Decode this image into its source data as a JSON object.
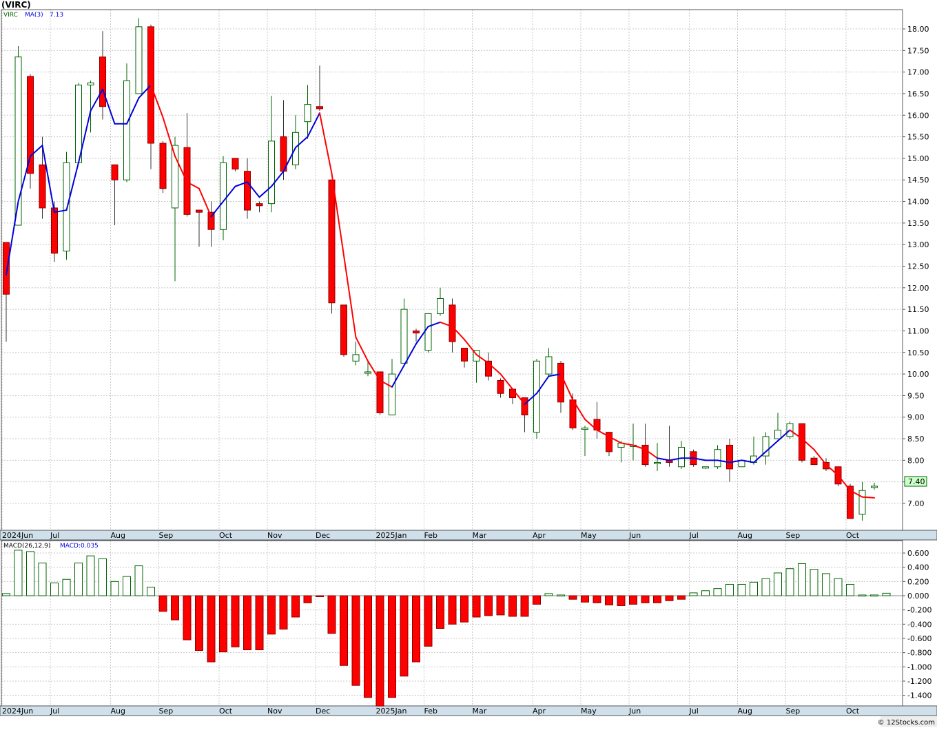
{
  "header": {
    "symbol": "(VIRC)",
    "legend_symbol": "VIRC",
    "legend_ma": "MA(3)",
    "legend_ma_value": "7.13",
    "macd_label": "MACD(26,12,9)",
    "macd_value": "MACD:0.035",
    "last_price": "7.40",
    "watermark": "© 12Stocks.com"
  },
  "colors": {
    "up": "#006400",
    "down": "#ff0000",
    "ma_up": "#0000dd",
    "ma_down": "#ff0000",
    "grid": "#c8c8c8",
    "axis_band": "#cfe0ea",
    "price_badge_bg": "#ccffcc"
  },
  "chart_data": [
    {
      "type": "candlestick",
      "title": "(VIRC)",
      "series_name": "VIRC",
      "overlay": "MA(3)",
      "ylim": [
        6.6,
        18.3
      ],
      "y_ticks": [
        7.0,
        7.5,
        8.0,
        8.5,
        9.0,
        9.5,
        10.0,
        10.5,
        11.0,
        11.5,
        12.0,
        12.5,
        13.0,
        13.5,
        14.0,
        14.5,
        15.0,
        15.5,
        16.0,
        16.5,
        17.0,
        17.5,
        18.0
      ],
      "y_tick_labels": [
        "7.00",
        "7.50",
        "8.00",
        "8.50",
        "9.00",
        "9.50",
        "10.00",
        "10.50",
        "11.00",
        "11.50",
        "12.00",
        "12.50",
        "13.00",
        "13.50",
        "14.00",
        "14.50",
        "15.00",
        "15.50",
        "16.00",
        "16.50",
        "17.00",
        "17.50",
        "18.00"
      ],
      "x_labels": [
        "2024Jun",
        "Jul",
        "Aug",
        "Sep",
        "Oct",
        "Nov",
        "Dec",
        "2025Jan",
        "Feb",
        "Mar",
        "Apr",
        "May",
        "Jun",
        "Jul",
        "Aug",
        "Sep",
        "Oct"
      ],
      "x_label_weeks": [
        0,
        4,
        9,
        13,
        18,
        22,
        26,
        31,
        35,
        39,
        44,
        48,
        52,
        57,
        61,
        65,
        70
      ],
      "ohlc": [
        [
          13.05,
          13.05,
          10.75,
          11.85
        ],
        [
          13.45,
          17.6,
          13.45,
          17.35
        ],
        [
          16.9,
          16.95,
          14.3,
          14.65
        ],
        [
          14.85,
          15.5,
          13.6,
          13.85
        ],
        [
          13.85,
          14.0,
          12.6,
          12.8
        ],
        [
          12.85,
          15.15,
          12.65,
          14.9
        ],
        [
          14.9,
          16.75,
          14.9,
          16.7
        ],
        [
          16.7,
          16.8,
          15.6,
          16.75
        ],
        [
          17.35,
          17.95,
          15.9,
          16.2
        ],
        [
          14.85,
          14.85,
          13.45,
          14.5
        ],
        [
          14.5,
          17.2,
          14.45,
          16.8
        ],
        [
          16.5,
          18.25,
          16.5,
          18.05
        ],
        [
          18.05,
          18.1,
          14.75,
          15.35
        ],
        [
          15.35,
          15.4,
          14.2,
          14.3
        ],
        [
          13.85,
          15.5,
          12.15,
          15.3
        ],
        [
          15.25,
          16.05,
          13.65,
          13.7
        ],
        [
          13.8,
          13.8,
          12.95,
          13.75
        ],
        [
          13.75,
          14.0,
          12.95,
          13.35
        ],
        [
          13.35,
          15.05,
          13.1,
          14.9
        ],
        [
          15.0,
          15.0,
          14.7,
          14.75
        ],
        [
          14.7,
          15.0,
          13.6,
          13.8
        ],
        [
          13.95,
          14.0,
          13.75,
          13.9
        ],
        [
          13.95,
          16.45,
          13.75,
          15.4
        ],
        [
          15.5,
          16.35,
          14.5,
          14.7
        ],
        [
          14.85,
          16.0,
          14.75,
          15.6
        ],
        [
          15.85,
          16.7,
          15.45,
          16.25
        ],
        [
          16.2,
          17.15,
          16.1,
          16.15
        ],
        [
          14.5,
          14.5,
          11.4,
          11.65
        ],
        [
          11.6,
          11.6,
          10.4,
          10.45
        ],
        [
          10.3,
          10.75,
          10.2,
          10.45
        ],
        [
          10.05,
          10.3,
          9.95,
          10.05
        ],
        [
          10.05,
          10.05,
          9.05,
          9.1
        ],
        [
          9.05,
          10.35,
          9.05,
          10.0
        ],
        [
          10.25,
          11.75,
          10.25,
          11.5
        ],
        [
          11.0,
          11.05,
          10.75,
          10.95
        ],
        [
          10.55,
          11.4,
          10.5,
          11.4
        ],
        [
          11.4,
          12.0,
          11.35,
          11.75
        ],
        [
          11.6,
          11.75,
          10.5,
          10.75
        ],
        [
          10.6,
          10.6,
          10.15,
          10.3
        ],
        [
          10.3,
          10.55,
          9.8,
          10.55
        ],
        [
          10.3,
          10.5,
          9.85,
          9.95
        ],
        [
          9.85,
          9.9,
          9.45,
          9.55
        ],
        [
          9.65,
          9.65,
          9.3,
          9.45
        ],
        [
          9.45,
          9.45,
          8.65,
          9.05
        ],
        [
          8.65,
          10.35,
          8.5,
          10.3
        ],
        [
          10.0,
          10.6,
          9.95,
          10.4
        ],
        [
          10.25,
          10.3,
          9.1,
          9.35
        ],
        [
          9.4,
          9.55,
          8.7,
          8.75
        ],
        [
          8.75,
          8.8,
          8.1,
          8.75
        ],
        [
          8.95,
          9.35,
          8.5,
          8.7
        ],
        [
          8.65,
          8.65,
          8.1,
          8.2
        ],
        [
          8.3,
          8.45,
          7.95,
          8.4
        ],
        [
          8.35,
          8.85,
          8.0,
          8.35
        ],
        [
          8.35,
          8.85,
          7.85,
          7.9
        ],
        [
          7.95,
          8.4,
          7.75,
          7.95
        ],
        [
          8.0,
          8.8,
          7.85,
          7.95
        ],
        [
          7.85,
          8.45,
          7.8,
          8.3
        ],
        [
          8.2,
          8.25,
          7.85,
          7.9
        ],
        [
          7.85,
          7.85,
          7.8,
          7.85
        ],
        [
          7.85,
          8.35,
          7.8,
          8.25
        ],
        [
          8.35,
          8.5,
          7.5,
          7.8
        ],
        [
          7.85,
          8.0,
          7.85,
          8.0
        ],
        [
          7.95,
          8.55,
          7.9,
          8.1
        ],
        [
          8.1,
          8.65,
          7.9,
          8.55
        ],
        [
          8.5,
          9.1,
          8.5,
          8.7
        ],
        [
          8.55,
          8.9,
          8.5,
          8.85
        ],
        [
          8.85,
          8.85,
          7.95,
          8.0
        ],
        [
          8.05,
          8.1,
          7.9,
          7.9
        ],
        [
          7.95,
          8.05,
          7.75,
          7.8
        ],
        [
          7.85,
          7.85,
          7.4,
          7.45
        ],
        [
          7.4,
          7.45,
          6.65,
          6.65
        ],
        [
          6.75,
          7.5,
          6.6,
          7.3
        ],
        [
          7.38,
          7.48,
          7.32,
          7.4
        ]
      ],
      "ma3": [
        12.3,
        14.0,
        15.05,
        15.3,
        13.75,
        13.8,
        14.9,
        16.1,
        16.6,
        15.8,
        15.8,
        16.4,
        16.7,
        15.95,
        15.05,
        14.45,
        14.3,
        13.65,
        14.0,
        14.35,
        14.45,
        14.1,
        14.35,
        14.7,
        15.25,
        15.5,
        16.05,
        14.65,
        12.75,
        10.85,
        10.3,
        9.85,
        9.7,
        10.2,
        10.7,
        11.1,
        11.2,
        11.1,
        10.8,
        10.45,
        10.25,
        10.0,
        9.65,
        9.3,
        9.55,
        9.95,
        10.0,
        9.4,
        8.95,
        8.7,
        8.55,
        8.4,
        8.35,
        8.25,
        8.05,
        8.0,
        8.05,
        8.05,
        8.0,
        8.0,
        7.95,
        8.0,
        7.95,
        8.2,
        8.45,
        8.7,
        8.5,
        8.25,
        7.9,
        7.65,
        7.3,
        7.15,
        7.13
      ],
      "ma_trend": [
        1,
        1,
        1,
        1,
        1,
        1,
        1,
        1,
        1,
        1,
        1,
        1,
        1,
        0,
        0,
        0,
        0,
        0,
        1,
        1,
        1,
        1,
        1,
        1,
        1,
        1,
        1,
        0,
        0,
        0,
        0,
        0,
        0,
        1,
        1,
        1,
        1,
        0,
        0,
        0,
        0,
        0,
        0,
        0,
        1,
        1,
        1,
        0,
        0,
        0,
        0,
        0,
        0,
        0,
        0,
        1,
        1,
        1,
        1,
        1,
        1,
        1,
        1,
        1,
        1,
        1,
        0,
        0,
        0,
        0,
        0,
        0,
        0
      ]
    },
    {
      "type": "bar",
      "title": "MACD(26,12,9)",
      "series_name": "MACD",
      "ylim": [
        -1.55,
        0.66
      ],
      "y_ticks": [
        0.6,
        0.4,
        0.2,
        0.0,
        -0.2,
        -0.4,
        -0.6,
        -0.8,
        -1.0,
        -1.2,
        -1.4
      ],
      "y_tick_labels": [
        "0.600",
        "0.400",
        "0.200",
        "0.000",
        "-0.200",
        "-0.400",
        "-0.600",
        "-0.800",
        "-1.000",
        "-1.200",
        "-1.400"
      ],
      "values": [
        0.03,
        0.64,
        0.62,
        0.46,
        0.18,
        0.23,
        0.46,
        0.56,
        0.52,
        0.2,
        0.27,
        0.42,
        0.12,
        -0.22,
        -0.34,
        -0.62,
        -0.77,
        -0.93,
        -0.79,
        -0.72,
        -0.76,
        -0.76,
        -0.54,
        -0.47,
        -0.3,
        -0.1,
        -0.01,
        -0.53,
        -0.98,
        -1.26,
        -1.43,
        -1.55,
        -1.43,
        -1.13,
        -0.93,
        -0.71,
        -0.46,
        -0.4,
        -0.37,
        -0.3,
        -0.28,
        -0.27,
        -0.29,
        -0.29,
        -0.12,
        0.03,
        0.01,
        -0.05,
        -0.09,
        -0.1,
        -0.13,
        -0.14,
        -0.12,
        -0.1,
        -0.1,
        -0.07,
        -0.05,
        0.04,
        0.07,
        0.1,
        0.16,
        0.16,
        0.19,
        0.24,
        0.32,
        0.38,
        0.45,
        0.37,
        0.31,
        0.24,
        0.16,
        0.01,
        0.01,
        0.035
      ],
      "x_labels": [
        "2024Jun",
        "Jul",
        "Aug",
        "Sep",
        "Oct",
        "Nov",
        "Dec",
        "2025Jan",
        "Feb",
        "Mar",
        "Apr",
        "May",
        "Jun",
        "Jul",
        "Aug",
        "Sep",
        "Oct"
      ]
    }
  ]
}
